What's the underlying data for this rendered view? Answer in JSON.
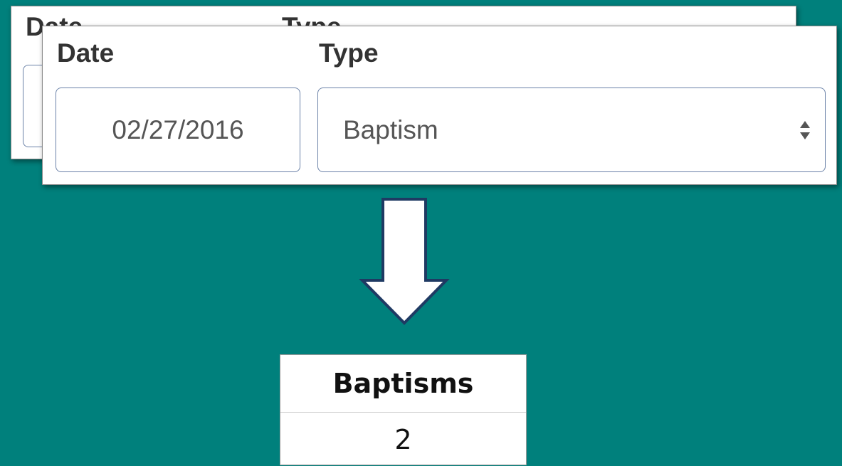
{
  "back_form": {
    "date_label": "Date",
    "type_label": "Type"
  },
  "front_form": {
    "date_label": "Date",
    "type_label": "Type",
    "date_value": "02/27/2016",
    "type_value": "Baptism"
  },
  "result_table": {
    "header": "Baptisms",
    "value": "2"
  },
  "icons": {
    "select_arrows": "up-down-caret-icon",
    "flow_arrow": "down-arrow-icon"
  },
  "colors": {
    "background": "#00807c",
    "input_border": "#6b82a8",
    "arrow_outline": "#1f3a63"
  }
}
